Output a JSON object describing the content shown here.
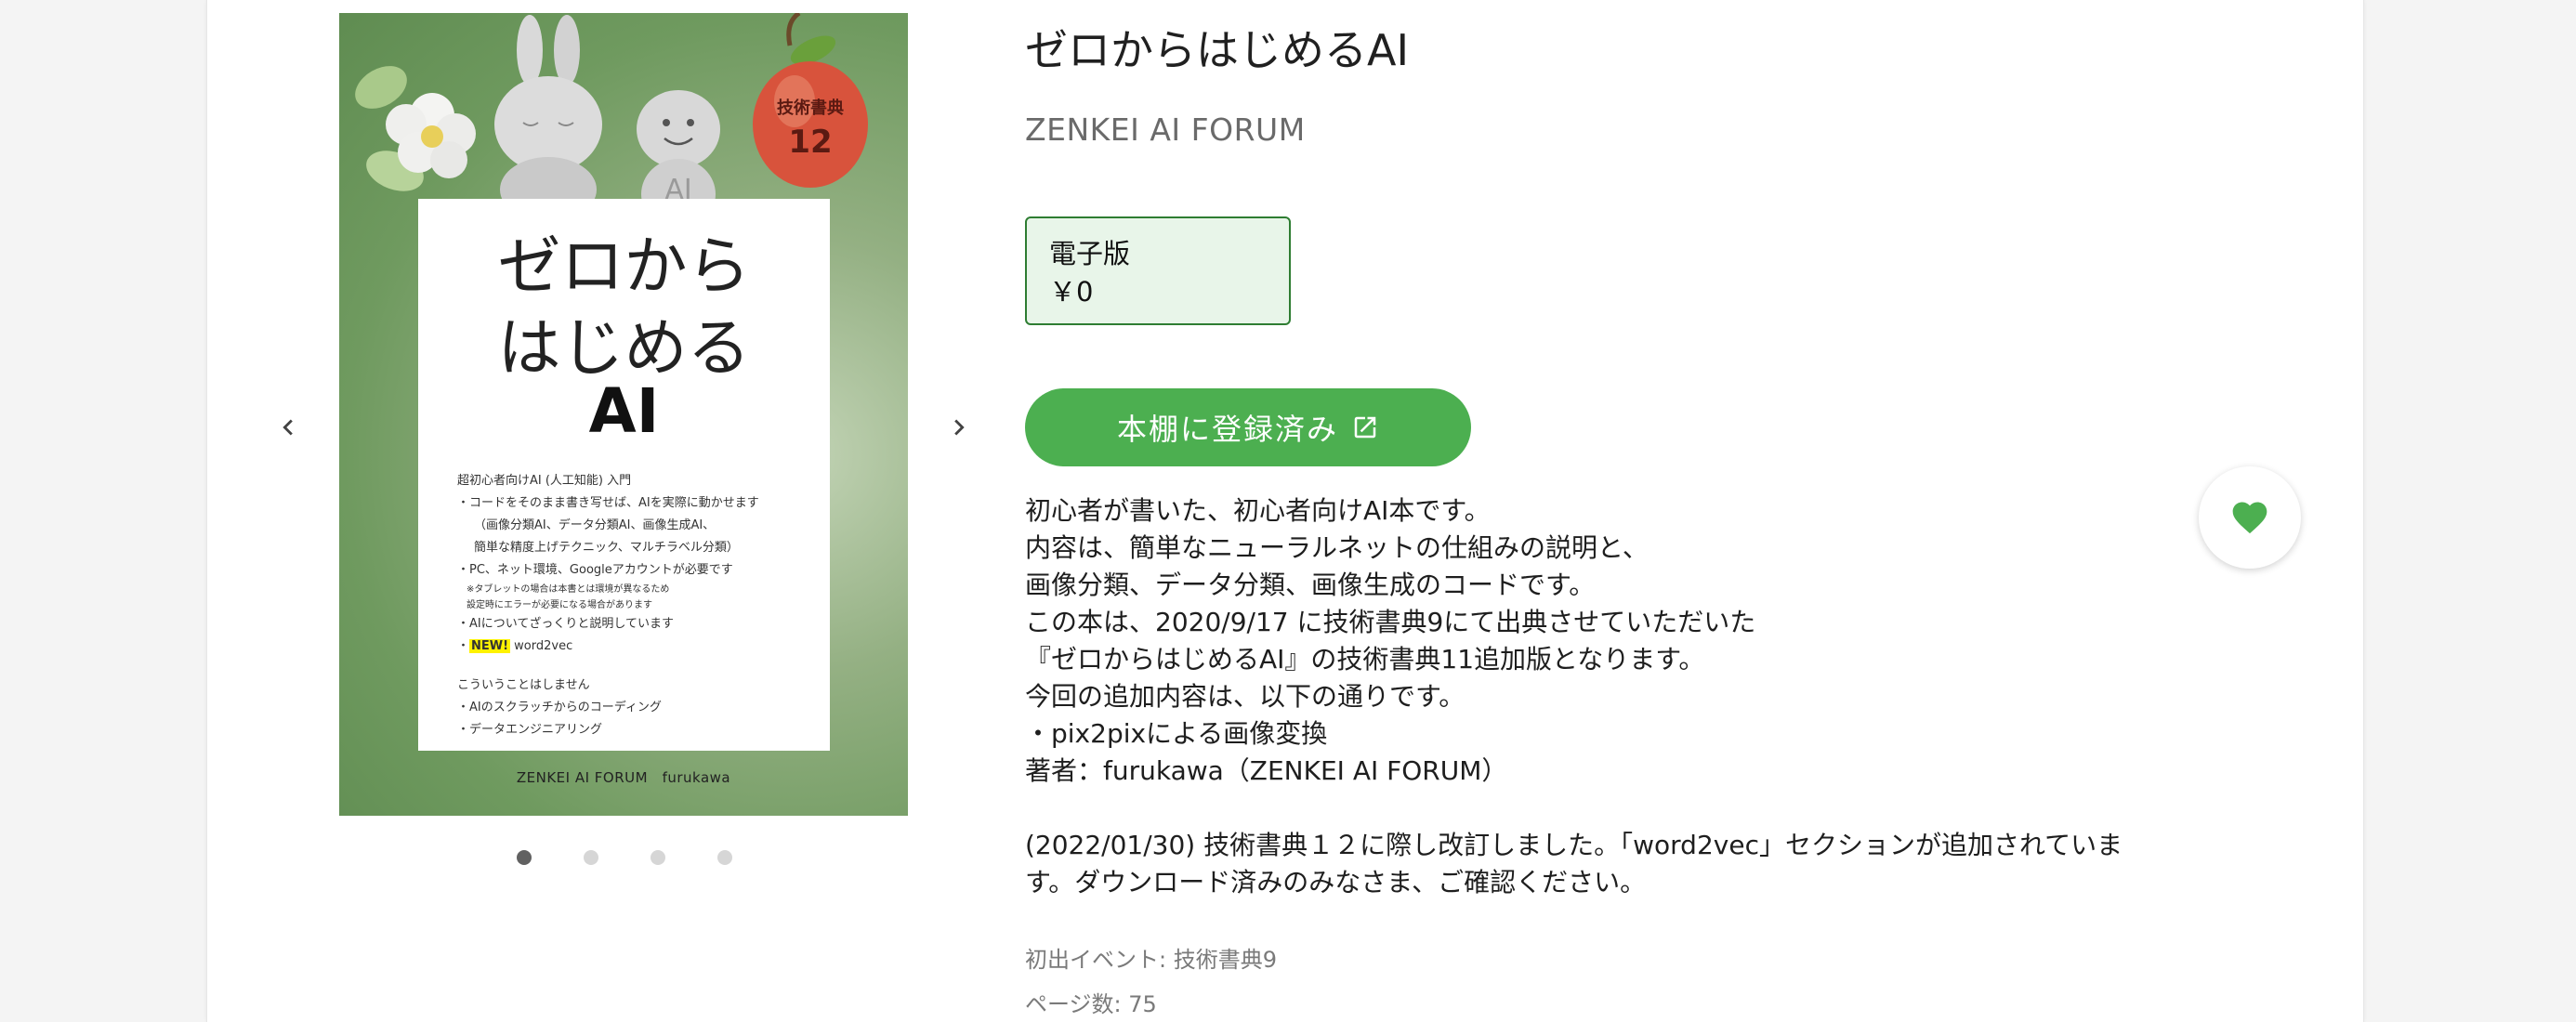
{
  "book": {
    "title": "ゼロからはじめるAI",
    "publisher": "ZENKEI AI FORUM",
    "edition": {
      "format": "電子版",
      "price": "￥0"
    },
    "shelf_button_label": "本棚に登録済み",
    "description_lines": [
      "初心者が書いた、初心者向けAI本です。",
      "内容は、簡単なニューラルネットの仕組みの説明と、",
      "画像分類、データ分類、画像生成のコードです。",
      "この本は、2020/9/17 に技術書典9にて出典させていただいた",
      "『ゼロからはじめるAI』の技術書典11追加版となります。",
      "今回の追加内容は、以下の通りです。",
      "・pix2pixによる画像変換",
      "著者：furukawa（ZENKEI AI FORUM）"
    ],
    "revision_lines": [
      "(2022/01/30) 技術書典１２に際し改訂しました。「word2vec」セクションが追加されていま",
      "す。ダウンロード済みのみなさま、ご確認ください。"
    ],
    "first_event": "初出イベント: 技術書典9",
    "page_count": "ページ数: 75"
  },
  "carousel": {
    "slide_count": 4,
    "active_index": 0,
    "prev_icon": "chevron-left-icon",
    "next_icon": "chevron-right-icon"
  },
  "cover": {
    "title_line1": "ゼロから",
    "title_line2": "はじめる",
    "title_ai": "AI",
    "badge_line1": "技術書典",
    "badge_line2": "12",
    "figure_label": "AI",
    "lines": [
      "超初心者向けAI (人工知能) 入門",
      "・コードをそのまま書き写せば、AIを実際に動かせます",
      "（画像分類AI、データ分類AI、画像生成AI、",
      "簡単な精度上げテクニック、マルチラベル分類）",
      "・PC、ネット環境、Googleアカウントが必要です",
      "※タブレットの場合は本書とは環境が異なるため",
      "設定時にエラーが必要になる場合があります",
      "・AIについてざっくりと説明しています"
    ],
    "new_mark": "NEW!",
    "new_item": " word2vec",
    "not_covered_heading": "こういうことはしません",
    "not_covered": [
      "・AIのスクラッチからのコーディング",
      "・データエンジニアリング"
    ],
    "footer": "ZENKEI AI FORUM　furukawa"
  },
  "colors": {
    "accent_green": "#4caf50",
    "price_border": "#2e7d32",
    "price_bg": "#e8f5e9"
  },
  "favorite_icon": "heart-icon"
}
